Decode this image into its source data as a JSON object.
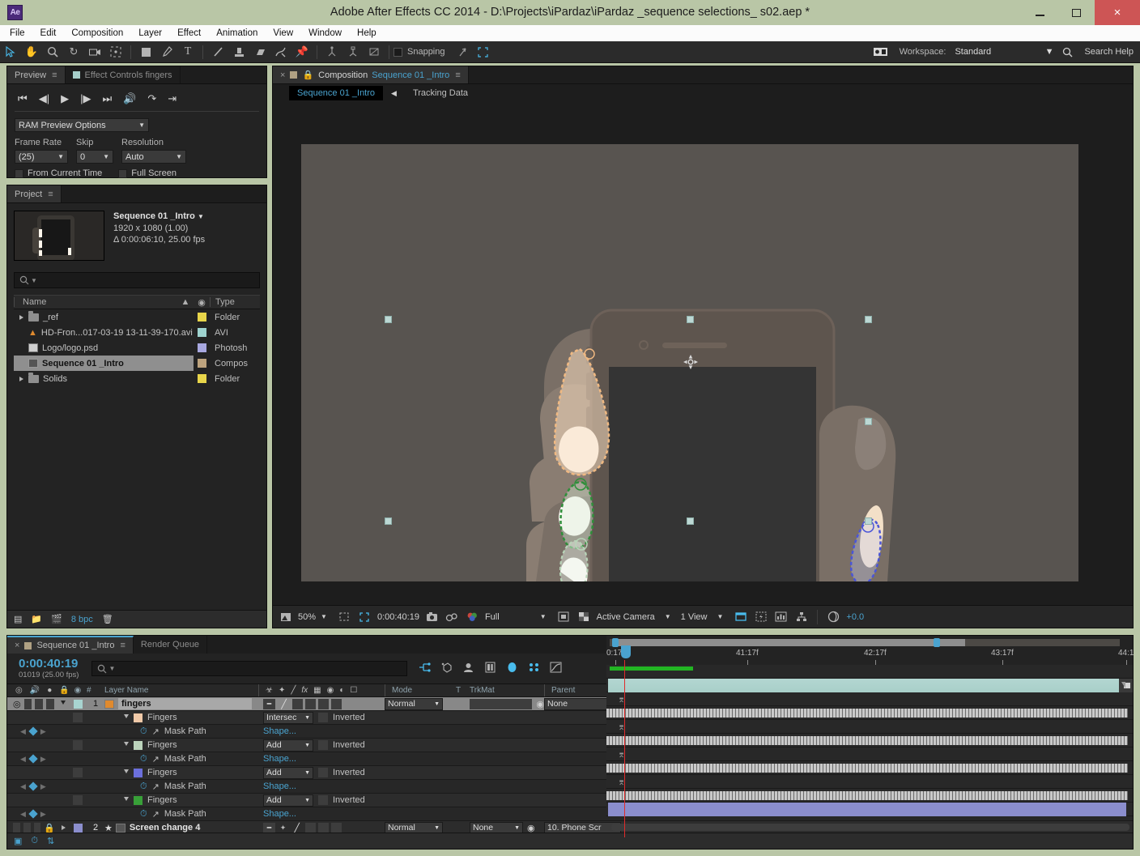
{
  "window": {
    "app_icon": "Ae",
    "title": "Adobe After Effects CC 2014 - D:\\Projects\\iPardaz\\iPardaz _sequence selections_ s02.aep *",
    "minimize": "minimize-icon",
    "maximize": "maximize-icon",
    "close": "×"
  },
  "menu": [
    "File",
    "Edit",
    "Composition",
    "Layer",
    "Effect",
    "Animation",
    "View",
    "Window",
    "Help"
  ],
  "toolbar": {
    "tools": [
      "selection-tool",
      "hand-tool",
      "zoom-tool",
      "rotation-tool",
      "camera-tool",
      "pan-behind-tool",
      "shape-tool",
      "pen-tool",
      "type-tool",
      "brush-tool",
      "clone-stamp-tool",
      "eraser-tool",
      "roto-brush-tool",
      "puppet-pin-tool"
    ],
    "rigid": [
      "local-axis",
      "world-axis",
      "view-axis"
    ],
    "snapping_label": "Snapping",
    "workspace_label": "Workspace:",
    "workspace_value": "Standard",
    "search_help": "Search Help"
  },
  "preview": {
    "tab": "Preview",
    "tab2": "Effect Controls  fingers",
    "ram_preview_options": "RAM Preview Options",
    "frame_rate_label": "Frame Rate",
    "frame_rate_value": "(25)",
    "skip_label": "Skip",
    "skip_value": "0",
    "resolution_label": "Resolution",
    "resolution_value": "Auto",
    "from_current_time": "From Current Time",
    "full_screen": "Full Screen"
  },
  "project": {
    "tab": "Project",
    "comp_name": "Sequence 01 _Intro",
    "dimensions": "1920 x 1080 (1.00)",
    "duration": "Δ 0:00:06:10, 25.00 fps",
    "search_placeholder": "",
    "columns": [
      "Name",
      "Type"
    ],
    "items": [
      {
        "name": "_ref",
        "type": "Folder",
        "color": "#e8d54a",
        "icon": "folder-icon",
        "expandable": true,
        "selected": false
      },
      {
        "name": "HD-Fron...017-03-19 13-11-39-170.avi",
        "type": "AVI",
        "color": "#9ed3cf",
        "icon": "video-file-icon",
        "expandable": false,
        "selected": false
      },
      {
        "name": "Logo/logo.psd",
        "type": "Photosh",
        "color": "#a8a8e0",
        "icon": "psd-file-icon",
        "expandable": false,
        "selected": false
      },
      {
        "name": "Sequence 01 _Intro",
        "type": "Compos",
        "color": "#bda37e",
        "icon": "composition-icon",
        "expandable": false,
        "selected": true
      },
      {
        "name": "Solids",
        "type": "Folder",
        "color": "#e8d54a",
        "icon": "folder-icon",
        "expandable": true,
        "selected": false
      }
    ],
    "bpc": "8 bpc"
  },
  "composition": {
    "tab_label": "Composition",
    "tab_name": "Sequence 01 _Intro",
    "view_tabs": [
      {
        "label": "Sequence 01 _Intro",
        "active": true
      },
      {
        "label": "Tracking Data",
        "active": false
      }
    ],
    "footer": {
      "zoom": "50%",
      "timecode": "0:00:40:19",
      "resolution": "Full",
      "camera": "Active Camera",
      "views": "1 View",
      "exposure": "+0.0"
    }
  },
  "timeline": {
    "tabs": [
      {
        "label": "Sequence 01 _Intro",
        "active": true
      },
      {
        "label": "Render Queue",
        "active": false
      }
    ],
    "current_time": "0:00:40:19",
    "frame_info": "01019 (25.00 fps)",
    "search_placeholder": "",
    "columns": [
      "Layer Name",
      "Mode",
      "T",
      "TrkMat",
      "Parent"
    ],
    "ruler_ticks": [
      "0:17f",
      "41:17f",
      "42:17f",
      "43:17f",
      "44:1"
    ],
    "layers": [
      {
        "kind": "layer",
        "index": "1",
        "name": "fingers",
        "mode": "Normal",
        "trkmat": "",
        "parent": "None",
        "selected": true,
        "color": "#a8d4d0",
        "icon": "av-file-icon"
      },
      {
        "kind": "mask",
        "name": "Fingers",
        "mode": "Intersec",
        "inverted": "Inverted",
        "color": "#f0c9a8"
      },
      {
        "kind": "prop",
        "name": "Mask Path",
        "value": "Shape...",
        "animated": true
      },
      {
        "kind": "mask",
        "name": "Fingers",
        "mode": "Add",
        "inverted": "Inverted",
        "color": "#bcd4bc"
      },
      {
        "kind": "prop",
        "name": "Mask Path",
        "value": "Shape...",
        "animated": true
      },
      {
        "kind": "mask",
        "name": "Fingers",
        "mode": "Add",
        "inverted": "Inverted",
        "color": "#6b6fdc"
      },
      {
        "kind": "prop",
        "name": "Mask Path",
        "value": "Shape...",
        "animated": true
      },
      {
        "kind": "mask",
        "name": "Fingers",
        "mode": "Add",
        "inverted": "Inverted",
        "color": "#38a038"
      },
      {
        "kind": "prop",
        "name": "Mask Path",
        "value": "Shape...",
        "animated": true
      },
      {
        "kind": "layer",
        "index": "2",
        "name": "Screen change 4",
        "mode": "Normal",
        "trkmat": "None",
        "parent": "10. Phone Scr",
        "selected": false,
        "color": "#8b8ecd",
        "icon": "solid-icon"
      }
    ]
  },
  "colors": {
    "accent_blue": "#4aa3cf",
    "titlebar": "#b9c6a6",
    "close_red": "#cd5555",
    "panel_bg": "#232323",
    "playhead_red": "#e02b2b",
    "work_area_green": "#22b523"
  }
}
